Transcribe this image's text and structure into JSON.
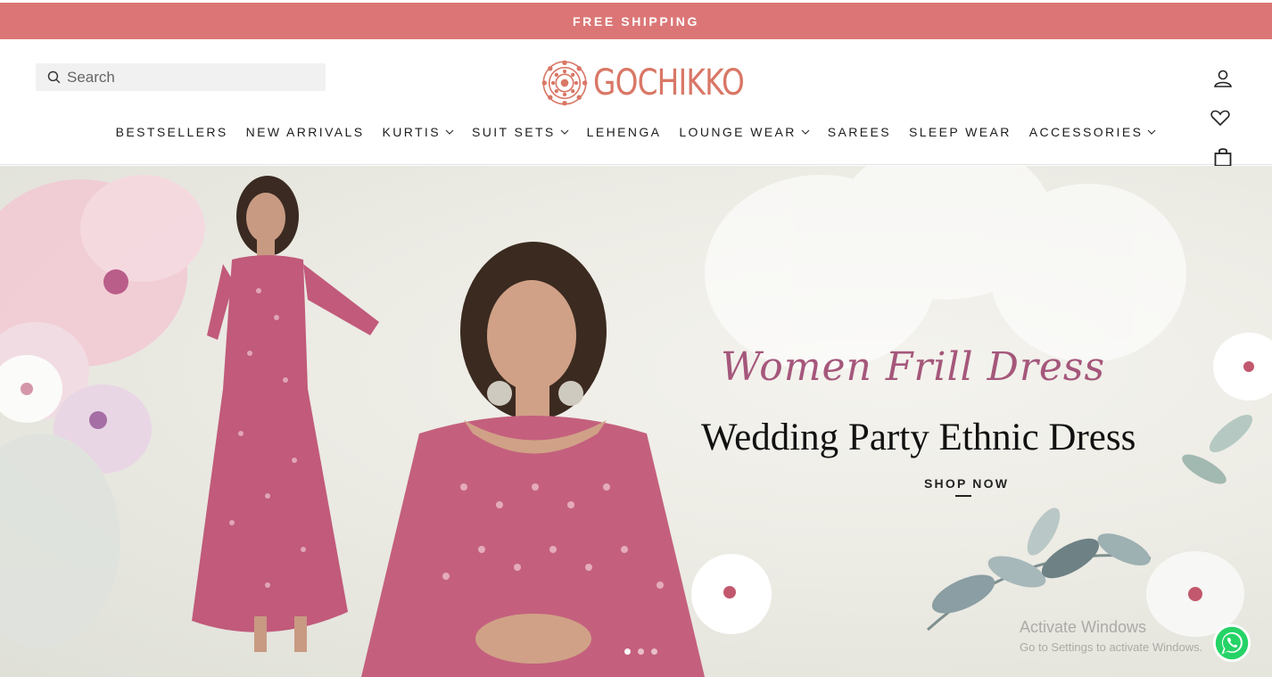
{
  "announcement": {
    "text": "FREE SHIPPING"
  },
  "colors": {
    "brand": "#dc7676",
    "logo": "#d97766",
    "script_title": "#a5577b"
  },
  "search": {
    "placeholder": "Search",
    "icon": "search-icon"
  },
  "logo": {
    "text": "GOCHIKKO"
  },
  "header_icons": {
    "account": "user-icon",
    "wishlist": "heart-icon",
    "cart": "shopping-bag-icon"
  },
  "nav": {
    "items": [
      {
        "label": "BESTSELLERS",
        "has_dropdown": false
      },
      {
        "label": "NEW ARRIVALS",
        "has_dropdown": false
      },
      {
        "label": "KURTIS",
        "has_dropdown": true
      },
      {
        "label": "SUIT SETS",
        "has_dropdown": true
      },
      {
        "label": "LEHENGA",
        "has_dropdown": false
      },
      {
        "label": "LOUNGE WEAR",
        "has_dropdown": true
      },
      {
        "label": "SAREES",
        "has_dropdown": false
      },
      {
        "label": "SLEEP WEAR",
        "has_dropdown": false
      },
      {
        "label": "ACCESSORIES",
        "has_dropdown": true
      }
    ]
  },
  "hero": {
    "script_title": "Women Frill Dress",
    "title": "Wedding Party Ethnic Dress",
    "cta": "SHOP NOW"
  },
  "watermark": {
    "line1": "Activate Windows",
    "line2": "Go to Settings to activate Windows."
  }
}
